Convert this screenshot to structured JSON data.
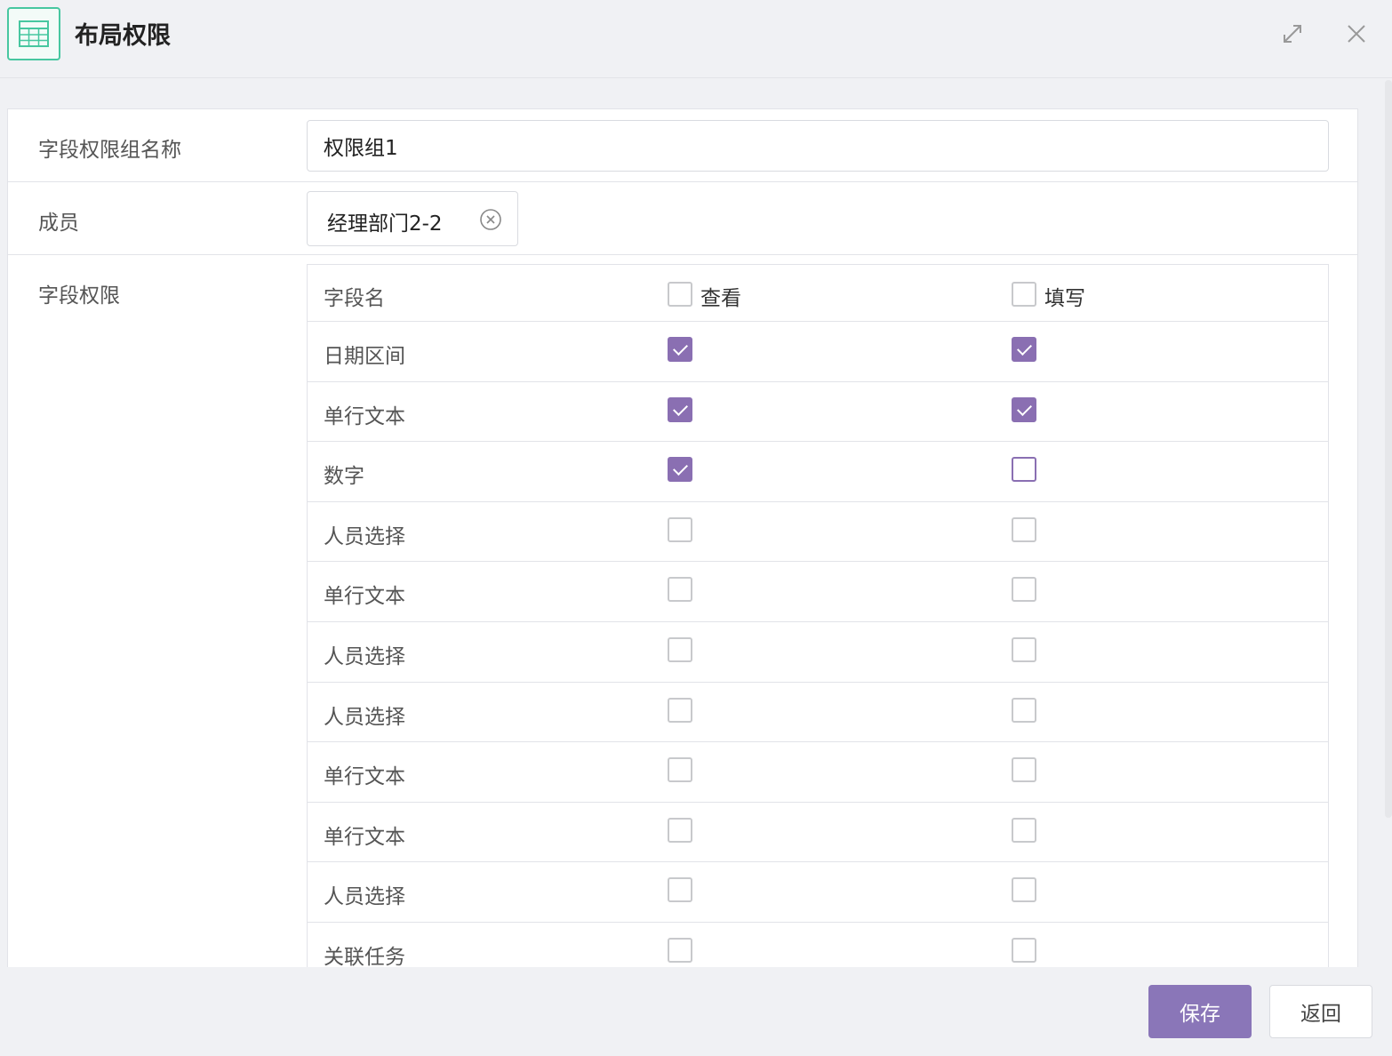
{
  "header": {
    "title": "布局权限"
  },
  "form": {
    "name_label": "字段权限组名称",
    "name_value": "权限组1",
    "member_label": "成员",
    "member_tag": "经理部门2-2",
    "perm_label": "字段权限"
  },
  "table": {
    "col_name": "字段名",
    "col_view": "查看",
    "col_edit": "填写",
    "rows": [
      {
        "name": "日期区间",
        "view": true,
        "edit": true
      },
      {
        "name": "单行文本",
        "view": true,
        "edit": true
      },
      {
        "name": "数字",
        "view": true,
        "edit": false
      },
      {
        "name": "人员选择",
        "view": false,
        "edit": false
      },
      {
        "name": "单行文本",
        "view": false,
        "edit": false
      },
      {
        "name": "人员选择",
        "view": false,
        "edit": false
      },
      {
        "name": "人员选择",
        "view": false,
        "edit": false
      },
      {
        "name": "单行文本",
        "view": false,
        "edit": false
      },
      {
        "name": "单行文本",
        "view": false,
        "edit": false
      },
      {
        "name": "人员选择",
        "view": false,
        "edit": false
      },
      {
        "name": "关联任务",
        "view": false,
        "edit": false
      }
    ]
  },
  "footer": {
    "save_label": "保存",
    "back_label": "返回"
  },
  "colors": {
    "accent": "#8a76b8",
    "icon_green": "#47c7a0"
  }
}
